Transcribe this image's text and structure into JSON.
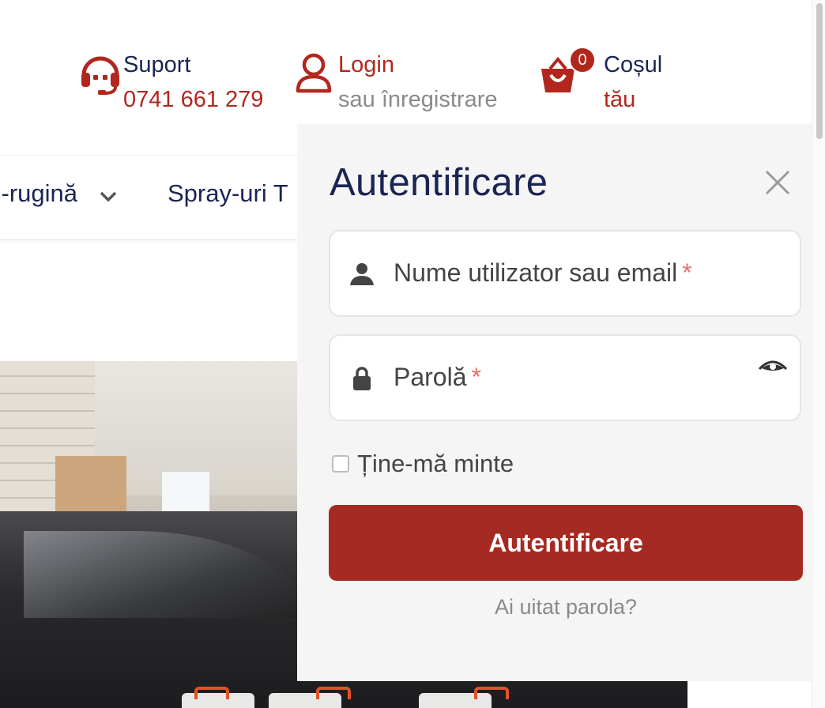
{
  "header": {
    "support": {
      "title": "Suport",
      "phone": "0741 661 279",
      "icon": "headset-icon"
    },
    "login": {
      "title": "Login",
      "subtitle": "sau înregistrare",
      "icon": "user-icon"
    },
    "cart": {
      "count": "0",
      "title": "Coșul",
      "subtitle": "tău",
      "icon": "shopping-bag-icon"
    }
  },
  "nav": {
    "items": [
      {
        "label": "ti-rugină"
      },
      {
        "label": "Spray-uri T"
      }
    ]
  },
  "login_panel": {
    "title": "Autentificare",
    "username": {
      "placeholder": "Nume utilizator sau email",
      "required_mark": "*"
    },
    "password": {
      "placeholder": "Parolă",
      "required_mark": "*"
    },
    "remember_label": "Ține-mă minte",
    "submit_label": "Autentificare",
    "forgot_link": "Ai uitat parola?"
  },
  "colors": {
    "brand_red": "#b1271e",
    "button_red": "#a52a22",
    "navy": "#1b2553",
    "panel_bg": "#f5f5f5"
  }
}
